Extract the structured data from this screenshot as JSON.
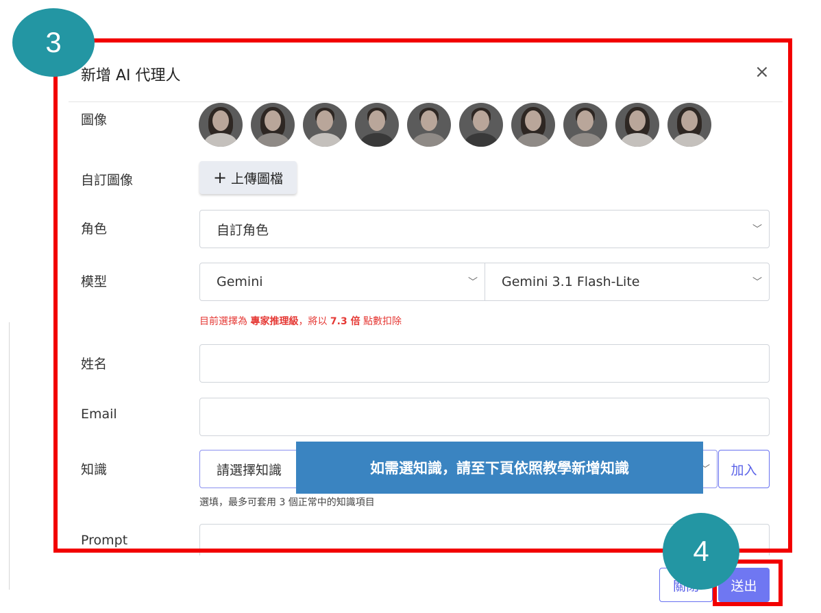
{
  "modal": {
    "title": "新增 AI 代理人",
    "close_icon": "×"
  },
  "labels": {
    "image": "圖像",
    "custom_image": "自訂圖像",
    "role": "角色",
    "model": "模型",
    "name": "姓名",
    "email": "Email",
    "knowledge": "知識",
    "prompt": "Prompt"
  },
  "avatars": [
    {
      "name": "avatar-1",
      "icon": "person-portrait-icon"
    },
    {
      "name": "avatar-2",
      "icon": "person-portrait-icon"
    },
    {
      "name": "avatar-3",
      "icon": "person-portrait-icon"
    },
    {
      "name": "avatar-4",
      "icon": "person-portrait-icon"
    },
    {
      "name": "avatar-5",
      "icon": "person-portrait-icon"
    },
    {
      "name": "avatar-6",
      "icon": "person-portrait-icon"
    },
    {
      "name": "avatar-7",
      "icon": "person-portrait-icon"
    },
    {
      "name": "avatar-8",
      "icon": "person-portrait-icon"
    },
    {
      "name": "avatar-9",
      "icon": "person-portrait-icon"
    },
    {
      "name": "avatar-10",
      "icon": "person-portrait-icon"
    }
  ],
  "upload": {
    "icon": "+",
    "label": "上傳圖檔"
  },
  "role_select": {
    "value": "自訂角色"
  },
  "model_select": {
    "provider": "Gemini",
    "model": "Gemini 3.1 Flash-Lite"
  },
  "notice": {
    "prefix": "目前選擇為 ",
    "level": "專家推理級",
    "middle": "，將以 ",
    "multiplier": "7.3 倍",
    "suffix": " 點數扣除"
  },
  "name_input": {
    "value": "",
    "placeholder": ""
  },
  "email_input": {
    "value": "",
    "placeholder": ""
  },
  "knowledge_select": {
    "value": "請選擇知識"
  },
  "knowledge_add_button": "加入",
  "knowledge_helper": "選填，最多可套用 3 個正常中的知識項目",
  "tooltip": "如需選知識，請至下頁依照教學新增知識",
  "footer": {
    "close_button": "關閉",
    "submit_button": "送出"
  },
  "badges": {
    "step_3": "3",
    "step_4": "4"
  },
  "colors": {
    "accent": "#6f77f2",
    "badge": "#2396a3",
    "highlight_frame": "#f20000",
    "tooltip_bg": "#3a84c1",
    "notice_text": "#e53935"
  }
}
